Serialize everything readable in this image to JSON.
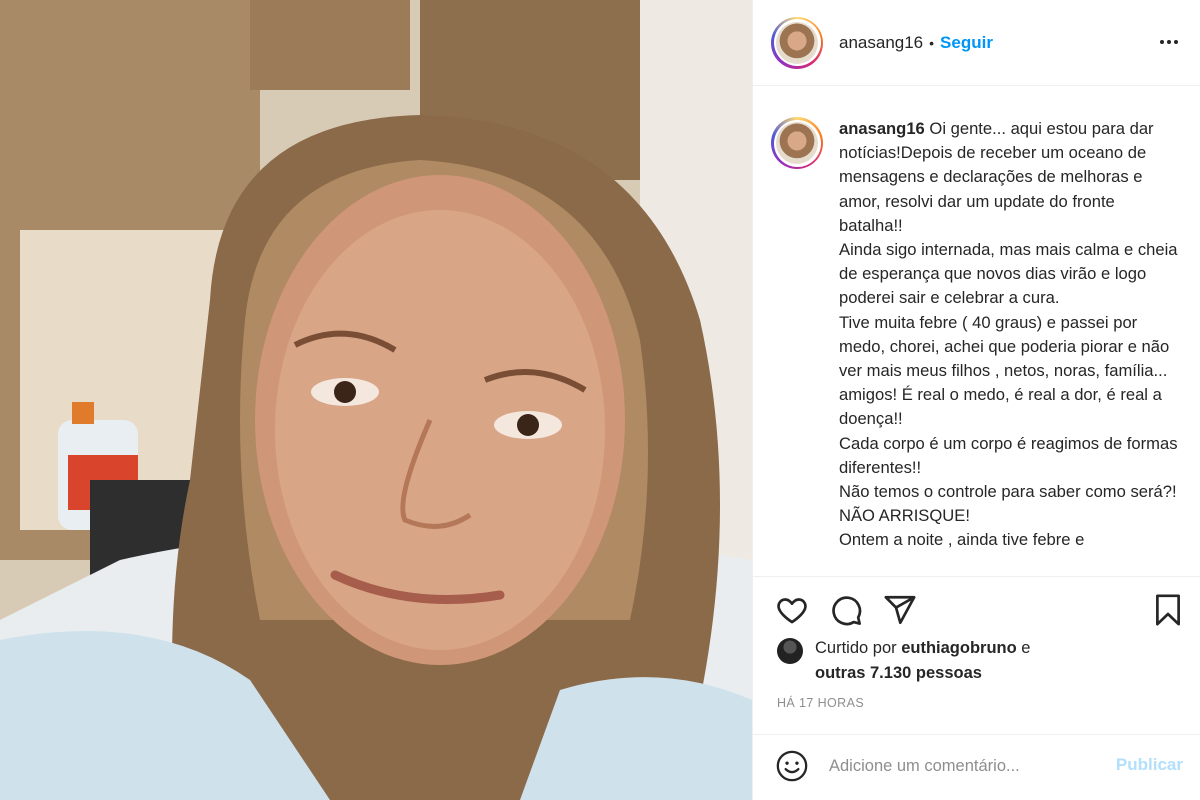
{
  "post": {
    "username": "anasang16",
    "dot": "•",
    "follow_label": "Seguir",
    "more_icon": "more-options-icon"
  },
  "caption": {
    "username": "anasang16",
    "text": "Oi gente... aqui estou para dar notícias!Depois de receber um oceano de mensagens e declarações de melhoras e amor, resolvi dar um update do fronte batalha!!\nAinda sigo internada, mas mais calma e cheia de esperança que novos dias virão e logo poderei sair e celebrar a cura.\nTive muita febre ( 40 graus) e passei por medo, chorei, achei que poderia piorar e não ver mais meus filhos , netos, noras, família... amigos! É real o medo, é real a dor, é real a doença!!\nCada corpo é um corpo é reagimos de formas diferentes!!\nNão temos o controle para saber como será?! NÃO ARRISQUE!\nOntem a noite , ainda tive febre e"
  },
  "actions": {
    "like_icon": "heart-icon",
    "comment_icon": "comment-icon",
    "share_icon": "send-icon",
    "save_icon": "bookmark-icon"
  },
  "likes": {
    "prefix": "Curtido por ",
    "liker": "euthiagobruno",
    "suffix": " e",
    "others": "outras 7.130 pessoas"
  },
  "timestamp": "HÁ 17 HORAS",
  "comment": {
    "placeholder": "Adicione um comentário...",
    "publish_label": "Publicar",
    "emoji_icon": "emoji-icon"
  },
  "colors": {
    "accent": "#0095f6",
    "publish_disabled": "#b2dffc",
    "text": "#262626",
    "muted": "#8e8e8e"
  }
}
